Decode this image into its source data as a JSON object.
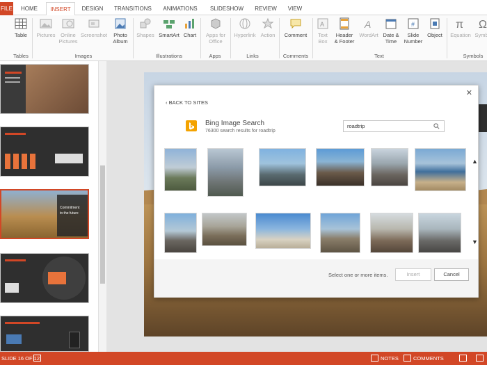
{
  "ribbon_tabs": {
    "file": "FILE",
    "home": "HOME",
    "insert": "INSERT",
    "design": "DESIGN",
    "transitions": "TRANSITIONS",
    "animations": "ANIMATIONS",
    "slideshow": "SLIDESHOW",
    "review": "REVIEW",
    "view": "VIEW"
  },
  "ribbon": {
    "table": "Table",
    "tables_group": "Tables",
    "pictures": "Pictures",
    "online_pictures_1": "Online",
    "online_pictures_2": "Pictures",
    "screenshot": "Screenshot",
    "photo_album_1": "Photo",
    "photo_album_2": "Album",
    "images_group": "Images",
    "shapes": "Shapes",
    "smartart": "SmartArt",
    "chart": "Chart",
    "illustrations_group": "Illustrations",
    "apps_for_office_1": "Apps for",
    "apps_for_office_2": "Office",
    "apps_group": "Apps",
    "hyperlink": "Hyperlink",
    "action": "Action",
    "links_group": "Links",
    "comment": "Comment",
    "comments_group": "Comments",
    "text_box_1": "Text",
    "text_box_2": "Box",
    "header_footer_1": "Header",
    "header_footer_2": "& Footer",
    "wordart": "WordArt",
    "date_time_1": "Date &",
    "date_time_2": "Time",
    "slide_number_1": "Slide",
    "slide_number_2": "Number",
    "object": "Object",
    "text_group": "Text",
    "equation": "Equation",
    "symbol": "Symbol",
    "symbols_group": "Symbols"
  },
  "dialog": {
    "back_label": "‹ BACK TO SITES",
    "bing_title": "Bing Image Search",
    "result_summary": "76300 search results for roadtrip",
    "search_value": "roadtrip",
    "status_text": "Select one or more items.",
    "insert_label": "Insert",
    "cancel_label": "Cancel",
    "close_glyph": "✕"
  },
  "statusbar": {
    "slide_indicator": "SLIDE 16 OF 12",
    "notes": "NOTES",
    "comments": "COMMENTS"
  },
  "thumb_texts": {
    "t3_line1": "Commitment",
    "t3_line2": "to the future"
  },
  "colors": {
    "accent": "#d24726",
    "bing": "#f4a300"
  }
}
